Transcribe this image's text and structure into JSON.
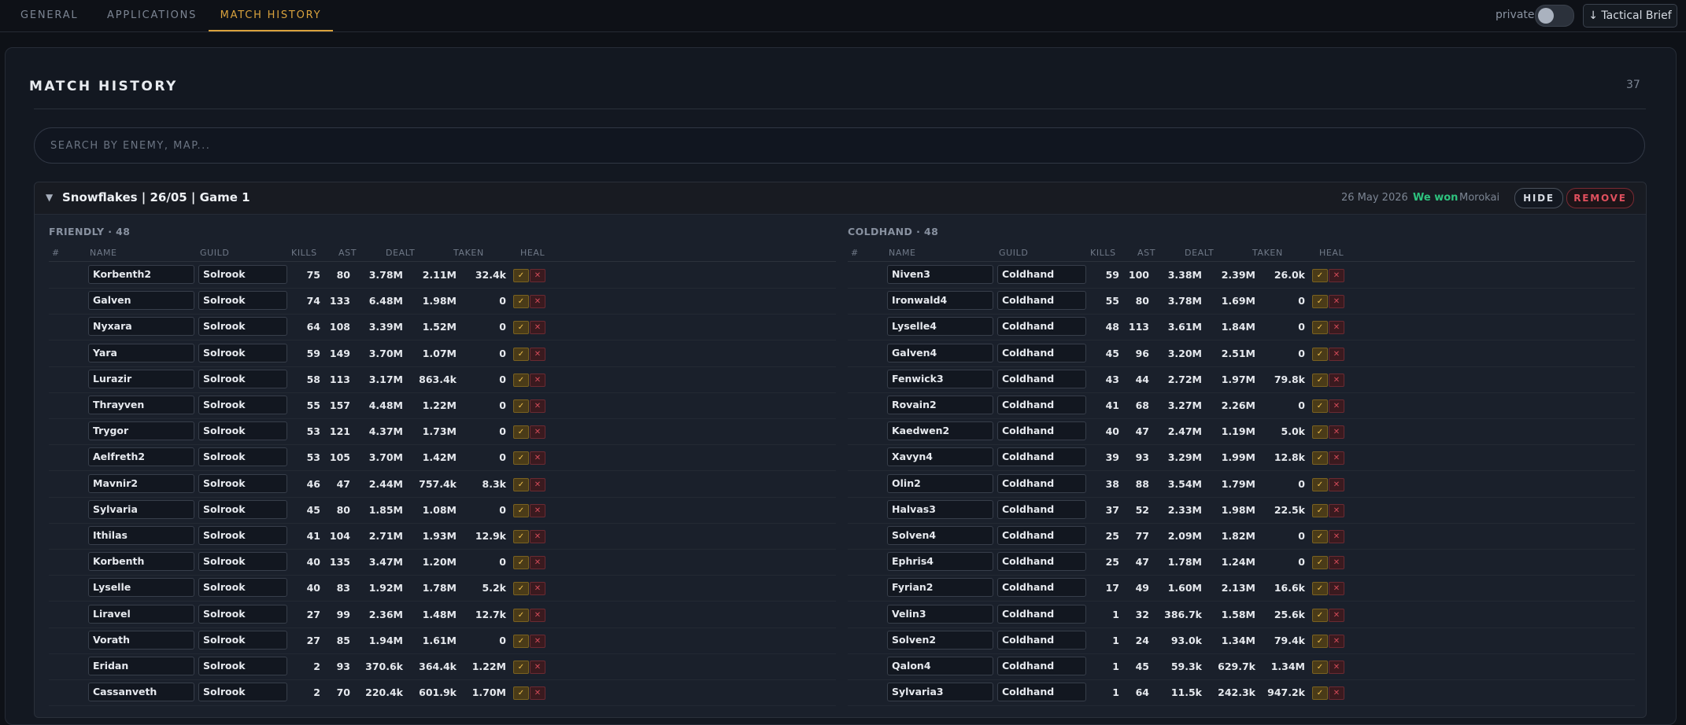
{
  "nav": {
    "tabs": [
      {
        "label": "GENERAL"
      },
      {
        "label": "APPLICATIONS"
      },
      {
        "label": "MATCH HISTORY"
      }
    ],
    "private_label": "private",
    "brief_label": "↓ Tactical Brief"
  },
  "colors": {
    "accent": "#d9a23d",
    "win": "#2ec27e",
    "danger": "#e0505e"
  },
  "panel": {
    "title": "MATCH HISTORY",
    "count": "37",
    "search_placeholder": "SEARCH BY ENEMY, MAP..."
  },
  "game": {
    "title": "Snowflakes | 26/05 | Game 1",
    "date": "26 May 2026",
    "result": "We won",
    "owner": "Morokai",
    "hide_label": "HIDE",
    "remove_label": "REMOVE",
    "columns": [
      "#",
      "NAME",
      "GUILD",
      "KILLS",
      "AST",
      "DEALT",
      "TAKEN",
      "HEAL"
    ],
    "check_glyph": "✓",
    "x_glyph": "✕",
    "teams": [
      {
        "label": "FRIENDLY · 48",
        "rows": [
          [
            "Korbenth2",
            "Solrook",
            "75",
            "80",
            "3.78M",
            "2.11M",
            "32.4k"
          ],
          [
            "Galven",
            "Solrook",
            "74",
            "133",
            "6.48M",
            "1.98M",
            "0"
          ],
          [
            "Nyxara",
            "Solrook",
            "64",
            "108",
            "3.39M",
            "1.52M",
            "0"
          ],
          [
            "Yara",
            "Solrook",
            "59",
            "149",
            "3.70M",
            "1.07M",
            "0"
          ],
          [
            "Lurazir",
            "Solrook",
            "58",
            "113",
            "3.17M",
            "863.4k",
            "0"
          ],
          [
            "Thrayven",
            "Solrook",
            "55",
            "157",
            "4.48M",
            "1.22M",
            "0"
          ],
          [
            "Trygor",
            "Solrook",
            "53",
            "121",
            "4.37M",
            "1.73M",
            "0"
          ],
          [
            "Aelfreth2",
            "Solrook",
            "53",
            "105",
            "3.70M",
            "1.42M",
            "0"
          ],
          [
            "Mavnir2",
            "Solrook",
            "46",
            "47",
            "2.44M",
            "757.4k",
            "8.3k"
          ],
          [
            "Sylvaria",
            "Solrook",
            "45",
            "80",
            "1.85M",
            "1.08M",
            "0"
          ],
          [
            "Ithilas",
            "Solrook",
            "41",
            "104",
            "2.71M",
            "1.93M",
            "12.9k"
          ],
          [
            "Korbenth",
            "Solrook",
            "40",
            "135",
            "3.47M",
            "1.20M",
            "0"
          ],
          [
            "Lyselle",
            "Solrook",
            "40",
            "83",
            "1.92M",
            "1.78M",
            "5.2k"
          ],
          [
            "Liravel",
            "Solrook",
            "27",
            "99",
            "2.36M",
            "1.48M",
            "12.7k"
          ],
          [
            "Vorath",
            "Solrook",
            "27",
            "85",
            "1.94M",
            "1.61M",
            "0"
          ],
          [
            "Eridan",
            "Solrook",
            "2",
            "93",
            "370.6k",
            "364.4k",
            "1.22M"
          ],
          [
            "Cassanveth",
            "Solrook",
            "2",
            "70",
            "220.4k",
            "601.9k",
            "1.70M"
          ]
        ]
      },
      {
        "label": "COLDHAND · 48",
        "rows": [
          [
            "Niven3",
            "Coldhand",
            "59",
            "100",
            "3.38M",
            "2.39M",
            "26.0k"
          ],
          [
            "Ironwald4",
            "Coldhand",
            "55",
            "80",
            "3.78M",
            "1.69M",
            "0"
          ],
          [
            "Lyselle4",
            "Coldhand",
            "48",
            "113",
            "3.61M",
            "1.84M",
            "0"
          ],
          [
            "Galven4",
            "Coldhand",
            "45",
            "96",
            "3.20M",
            "2.51M",
            "0"
          ],
          [
            "Fenwick3",
            "Coldhand",
            "43",
            "44",
            "2.72M",
            "1.97M",
            "79.8k"
          ],
          [
            "Rovain2",
            "Coldhand",
            "41",
            "68",
            "3.27M",
            "2.26M",
            "0"
          ],
          [
            "Kaedwen2",
            "Coldhand",
            "40",
            "47",
            "2.47M",
            "1.19M",
            "5.0k"
          ],
          [
            "Xavyn4",
            "Coldhand",
            "39",
            "93",
            "3.29M",
            "1.99M",
            "12.8k"
          ],
          [
            "Olin2",
            "Coldhand",
            "38",
            "88",
            "3.54M",
            "1.79M",
            "0"
          ],
          [
            "Halvas3",
            "Coldhand",
            "37",
            "52",
            "2.33M",
            "1.98M",
            "22.5k"
          ],
          [
            "Solven4",
            "Coldhand",
            "25",
            "77",
            "2.09M",
            "1.82M",
            "0"
          ],
          [
            "Ephris4",
            "Coldhand",
            "25",
            "47",
            "1.78M",
            "1.24M",
            "0"
          ],
          [
            "Fyrian2",
            "Coldhand",
            "17",
            "49",
            "1.60M",
            "2.13M",
            "16.6k"
          ],
          [
            "Velin3",
            "Coldhand",
            "1",
            "32",
            "386.7k",
            "1.58M",
            "25.6k"
          ],
          [
            "Solven2",
            "Coldhand",
            "1",
            "24",
            "93.0k",
            "1.34M",
            "79.4k"
          ],
          [
            "Qalon4",
            "Coldhand",
            "1",
            "45",
            "59.3k",
            "629.7k",
            "1.34M"
          ],
          [
            "Sylvaria3",
            "Coldhand",
            "1",
            "64",
            "11.5k",
            "242.3k",
            "947.2k"
          ]
        ]
      }
    ]
  }
}
